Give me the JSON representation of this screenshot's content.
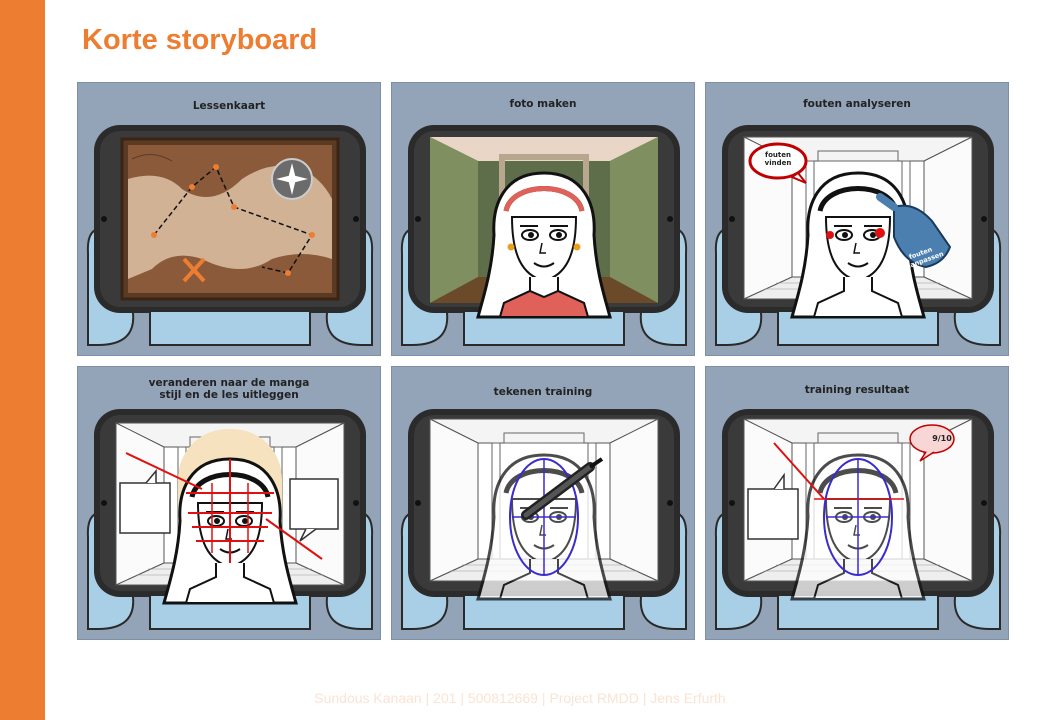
{
  "slide": {
    "title": "Korte storyboard",
    "footer": "Sundous Kanaan | 201 | 500812669 | Project RMDD | Jens Erfurth"
  },
  "panels": [
    {
      "title": "Lessenkaart"
    },
    {
      "title": "foto maken"
    },
    {
      "title": "fouten analyseren",
      "bubble_text": "fouten vinden",
      "hand_text": "fouten aanpassen"
    },
    {
      "title_line1": "veranderen naar de manga",
      "title_line2": "stijl en de les uitleggen"
    },
    {
      "title": "tekenen training"
    },
    {
      "title": "training resultaat",
      "score": "9/10"
    }
  ],
  "colors": {
    "accent": "#ED7D31",
    "panel_bg": "#93A3B8",
    "tablet": "#2b2b2b",
    "hands": "#A9CFE6"
  }
}
